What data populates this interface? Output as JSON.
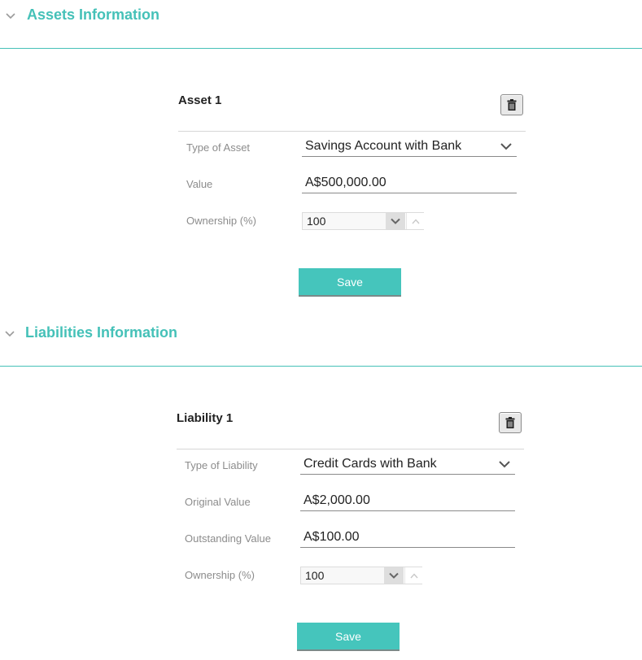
{
  "assets": {
    "section_title": "Assets Information",
    "card_title": "Asset 1",
    "type_label": "Type of Asset",
    "type_value": "Savings Account with Bank",
    "value_label": "Value",
    "value_value": "A$500,000.00",
    "ownership_label": "Ownership (%)",
    "ownership_value": "100",
    "save_label": "Save"
  },
  "liabilities": {
    "section_title": "Liabilities Information",
    "card_title": "Liability 1",
    "type_label": "Type of Liability",
    "type_value": "Credit Cards with Bank",
    "original_label": "Original Value",
    "original_value": "A$2,000.00",
    "outstanding_label": "Outstanding Value",
    "outstanding_value": "A$100.00",
    "ownership_label": "Ownership (%)",
    "ownership_value": "100",
    "save_label": "Save"
  },
  "icons": {
    "section_collapse": "chevron-down-icon",
    "delete": "trash-icon",
    "select_dropdown": "chevron-down-icon",
    "decrement": "chevron-down-icon",
    "increment": "chevron-up-icon"
  },
  "colors": {
    "accent": "#45c1b8",
    "button": "#45c5bc",
    "label": "#8c8c8c"
  }
}
